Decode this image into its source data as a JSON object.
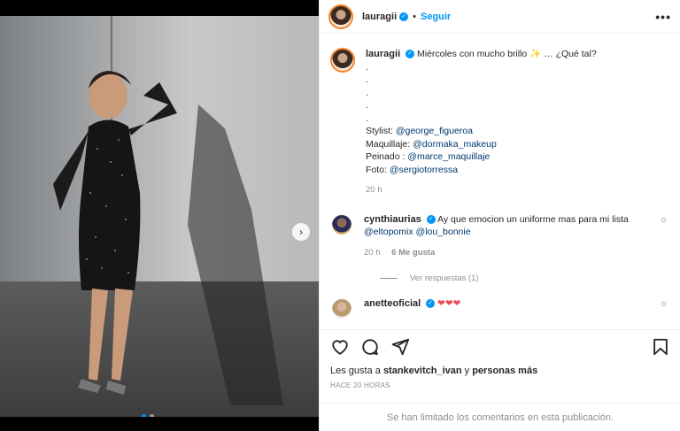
{
  "post": {
    "author": "lauragii",
    "follow_label": "Seguir",
    "separator": "•",
    "more_label": "•••",
    "nav_arrow": "›",
    "caption": {
      "text": "Miércoles con mucho brillo ✨ … ¿Qué tal?",
      "dots": [
        ".",
        ".",
        ".",
        ".",
        "."
      ],
      "credits": [
        {
          "label": "Stylist: ",
          "handle": "@george_figueroa"
        },
        {
          "label": "Maquillaje: ",
          "handle": "@dormaka_makeup"
        },
        {
          "label": "Peinado : ",
          "handle": "@marce_maquillaje"
        },
        {
          "label": "Foto: ",
          "handle": "@sergiotorressa"
        }
      ],
      "time": "20 h"
    },
    "comments": [
      {
        "author": "cynthiaurias",
        "text": "Ay que emocion un uniforme mas para mi lista ",
        "mentions": [
          "@eltopomix",
          "@lou_bonnie"
        ],
        "time": "20 h",
        "likes": "6 Me gusta",
        "view_replies": "Ver respuestas (1)"
      },
      {
        "author": "anetteoficial",
        "text": "❤❤❤"
      }
    ],
    "likes_prefix": "Les gusta a ",
    "likes_user": "stankevitch_ivan",
    "likes_and": " y ",
    "likes_others": "personas más",
    "posted_ago": "HACE 20 HORAS",
    "comments_limited": "Se han limitado los comentarios en esta publicación."
  }
}
